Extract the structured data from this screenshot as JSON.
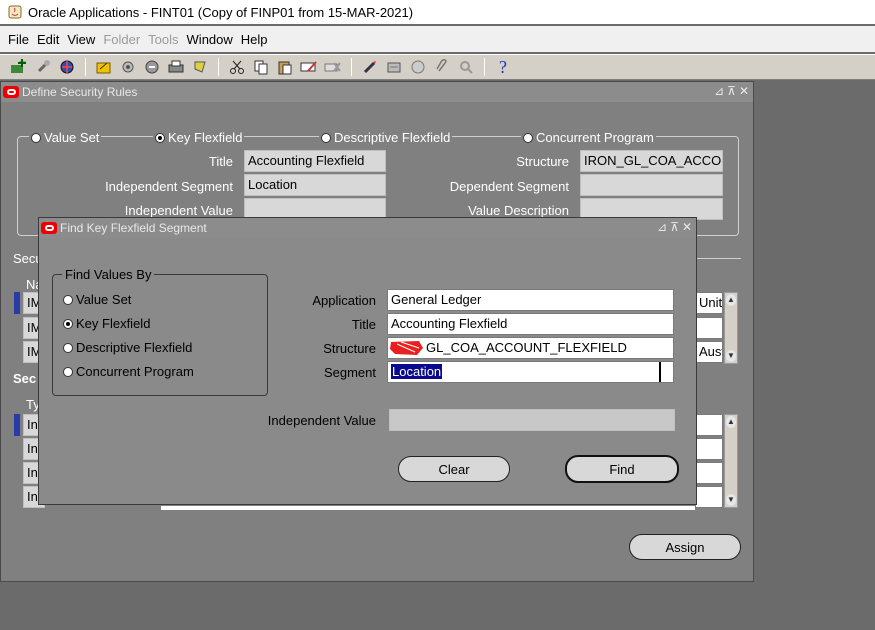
{
  "window": {
    "title": "Oracle Applications - FINT01 (Copy of FINP01 from 15-MAR-2021)"
  },
  "menu": [
    {
      "label": "File",
      "enabled": true
    },
    {
      "label": "Edit",
      "enabled": true
    },
    {
      "label": "View",
      "enabled": true
    },
    {
      "label": "Folder",
      "enabled": false
    },
    {
      "label": "Tools",
      "enabled": false
    },
    {
      "label": "Window",
      "enabled": true
    },
    {
      "label": "Help",
      "enabled": true
    }
  ],
  "toolbar": {
    "icons": [
      "new-record-icon",
      "pin-icon",
      "globe-icon",
      "folder-icon",
      "settings-icon",
      "navigate-icon",
      "print-icon",
      "bookmark-icon",
      "cut-icon",
      "copy-icon",
      "paste-icon",
      "edit-field-icon",
      "clear-record-icon",
      "attach-pen-icon",
      "folder-tools-icon",
      "record-history-icon",
      "paperclip-icon",
      "zoom-icon",
      "help-icon"
    ],
    "help_glyph": "?"
  },
  "security_rules": {
    "title": "Define Security Rules",
    "radios": {
      "value_set": "Value Set",
      "key_flexfield": "Key Flexfield",
      "descriptive_flexfield": "Descriptive Flexfield",
      "concurrent_program": "Concurrent Program",
      "selected": "key_flexfield"
    },
    "labels": {
      "title": "Title",
      "independent_segment": "Independent Segment",
      "independent_value": "Independent Value",
      "structure": "Structure",
      "dependent_segment": "Dependent Segment",
      "value_description": "Value Description"
    },
    "values": {
      "title": "Accounting Flexfield",
      "independent_segment": "Location",
      "structure": "IRON_GL_COA_ACCOU"
    },
    "section_labels": {
      "sec1": "Secu",
      "name": "Na",
      "sec2": "Sec",
      "type": "Ty"
    },
    "rows1": [
      "IM",
      "IM",
      "IM"
    ],
    "rows1_right": [
      "Unite",
      "",
      "Aust"
    ],
    "rows2": [
      "In",
      "In",
      "In",
      "In"
    ],
    "assign_label": "Assign"
  },
  "find_dialog": {
    "title": "Find Key Flexfield Segment",
    "group_label": "Find Values By",
    "radios": {
      "value_set": "Value Set",
      "key_flexfield": "Key Flexfield",
      "descriptive_flexfield": "Descriptive Flexfield",
      "concurrent_program": "Concurrent Program",
      "selected": "key_flexfield"
    },
    "labels": {
      "application": "Application",
      "title": "Title",
      "structure": "Structure",
      "segment": "Segment",
      "independent_value": "Independent Value"
    },
    "values": {
      "application": "General Ledger",
      "title": "Accounting Flexfield",
      "structure": "GL_COA_ACCOUNT_FLEXFIELD",
      "segment": "Location",
      "independent_value": ""
    },
    "clear_label": "Clear",
    "find_label": "Find"
  },
  "colors": {
    "selection": "#0a0a8c",
    "redaction": "#e82020"
  }
}
